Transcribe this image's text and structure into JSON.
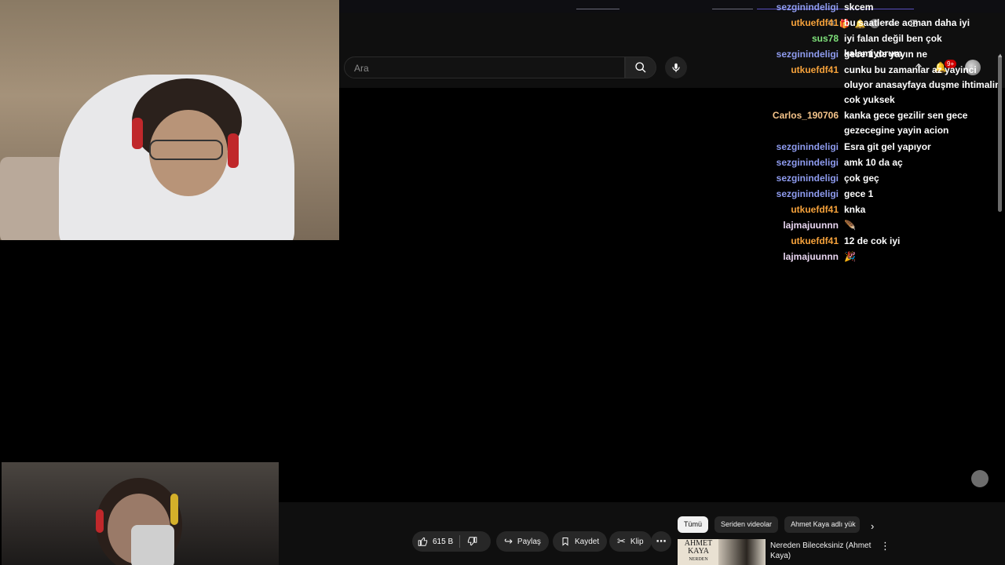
{
  "search": {
    "placeholder": "Ara"
  },
  "header": {
    "notifications_badge": "9+"
  },
  "chat": {
    "messages": [
      {
        "user": "sezginindeligi",
        "color": "#8f9cf0",
        "text": "skcem"
      },
      {
        "user": "utkuefdf41",
        "color": "#f6a23b",
        "text": "bu saatlerde acman daha iyi"
      },
      {
        "user": "sus78",
        "color": "#7ee07a",
        "text": "iyi falan değil ben çok kalamiyorum"
      },
      {
        "user": "sezginindeligi",
        "color": "#8f9cf0",
        "text": "gece 1 de yayın ne"
      },
      {
        "user": "utkuefdf41",
        "color": "#f6a23b",
        "text": "cunku bu zamanlar az yayinci oluyor anasayfaya duşme ihtimalin cok yuksek"
      },
      {
        "user": "Carlos_190706",
        "color": "#f5c48a",
        "text": "kanka gece gezilir sen gece gezecegine yayin acion"
      },
      {
        "user": "sezginindeligi",
        "color": "#8f9cf0",
        "text": "Esra git gel yapıyor"
      },
      {
        "user": "sezginindeligi",
        "color": "#8f9cf0",
        "text": "amk 10 da aç"
      },
      {
        "user": "sezginindeligi",
        "color": "#8f9cf0",
        "text": "çok geç"
      },
      {
        "user": "sezginindeligi",
        "color": "#8f9cf0",
        "text": "gece 1"
      },
      {
        "user": "utkuefdf41",
        "color": "#f6a23b",
        "text": "knka"
      },
      {
        "user": "lajmajuunnn",
        "color": "#e8d5f0",
        "text": "🪶"
      },
      {
        "user": "utkuefdf41",
        "color": "#f6a23b",
        "text": "12 de cok iyi"
      },
      {
        "user": "lajmajuunnn",
        "color": "#e8d5f0",
        "text": "🎉"
      }
    ]
  },
  "actions": {
    "likes": "615 B",
    "share": "Paylaş",
    "save": "Kaydet",
    "clip": "Klip"
  },
  "chips": [
    "Tümü",
    "Seriden videolar",
    "Ahmet Kaya adlı yük"
  ],
  "recommendation": {
    "thumb_text_1": "AHMET",
    "thumb_text_2": "KAYA",
    "thumb_text_3": "NERDEN",
    "title": "Nereden Bileceksiniz (Ahmet Kaya)"
  }
}
